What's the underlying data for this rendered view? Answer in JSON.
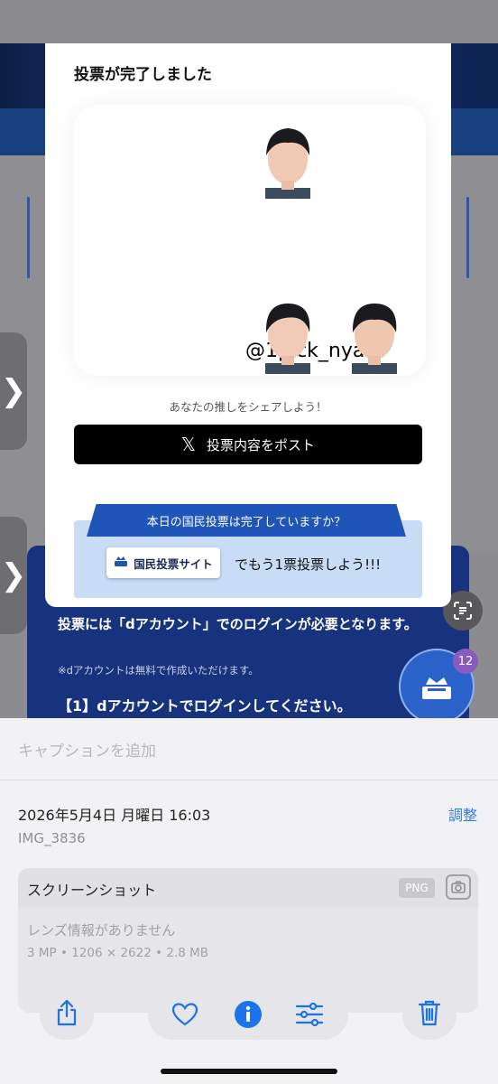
{
  "background": {
    "side_tab_glyph": "❯",
    "panel_text_login": "投票には「dアカウント」でのログインが必要となります。",
    "panel_text_free": "※dアカウントは無料で作成いただけます。",
    "panel_text_step": "【1】dアカウントでログインしてください。",
    "badge_count": "12"
  },
  "modal": {
    "title": "投票が完了しました",
    "handle": "@1pick_nyan",
    "share_hint": "あなたの推しをシェアしよう！",
    "post_button": "投票内容をポスト",
    "x_glyph": "𝕏",
    "vote_question": "本日の国民投票は完了していますか？",
    "site_button": "国民投票サイト",
    "vote_more": "でもう1票投票しよう!!!"
  },
  "sheet": {
    "caption_placeholder": "キャプションを追加",
    "date": "2026年5月4日 月曜日 16:03",
    "adjust": "調整",
    "filename": "IMG_3836",
    "meta_title": "スクリーンショット",
    "format_badge": "PNG",
    "lens_info": "レンズ情報がありません",
    "specs": "3 MP • 1206 × 2622 • 2.8 MB"
  },
  "icons": {
    "share": "share-icon",
    "favorite": "heart-icon",
    "info": "info-icon",
    "adjust": "sliders-icon",
    "delete": "trash-icon",
    "lens": "visual-lookup-icon",
    "camera": "camera-icon"
  },
  "colors": {
    "accent": "#1a73e8",
    "post_button": "#000000",
    "vote_ribbon": "#1f55b8",
    "vote_box": "#c9dcf5",
    "panel": "#17337d"
  }
}
